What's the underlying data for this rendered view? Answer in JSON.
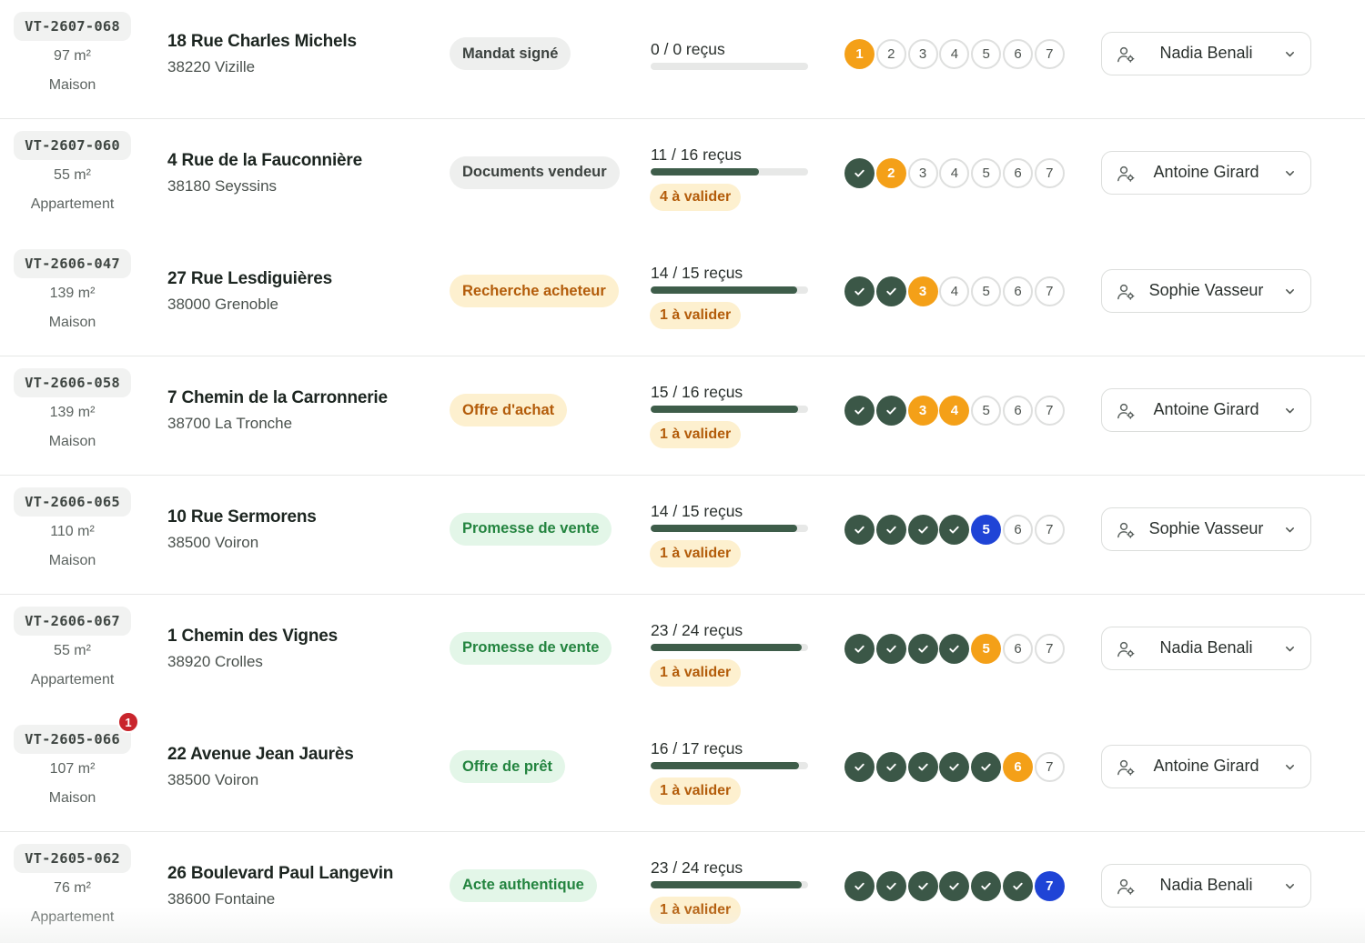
{
  "rows": [
    {
      "ref": "VT-2607-068",
      "area": "97 m²",
      "type": "Maison",
      "street": "18 Rue Charles Michels",
      "city": "38220 Vizille",
      "status": "Mandat signé",
      "status_tone": "neutral",
      "docs": "0 / 0 reçus",
      "progress": 0,
      "pending": "",
      "steps": [
        "cur",
        "todo",
        "todo",
        "todo",
        "todo",
        "todo",
        "todo"
      ],
      "assignee": "Nadia Benali",
      "notif": ""
    },
    {
      "ref": "VT-2607-060",
      "area": "55 m²",
      "type": "Appartement",
      "street": "4 Rue de la Fauconnière",
      "city": "38180 Seyssins",
      "status": "Documents vendeur",
      "status_tone": "neutral",
      "docs": "11 / 16 reçus",
      "progress": 0.6875,
      "pending": "4 à valider",
      "steps": [
        "done",
        "cur",
        "todo",
        "todo",
        "todo",
        "todo",
        "todo"
      ],
      "assignee": "Antoine Girard",
      "notif": ""
    },
    {
      "ref": "VT-2606-047",
      "area": "139 m²",
      "type": "Maison",
      "street": "27 Rue Lesdiguières",
      "city": "38000 Grenoble",
      "status": "Recherche acheteur",
      "status_tone": "amber",
      "docs": "14 / 15 reçus",
      "progress": 0.9333,
      "pending": "1 à valider",
      "steps": [
        "done",
        "done",
        "cur",
        "todo",
        "todo",
        "todo",
        "todo"
      ],
      "assignee": "Sophie Vasseur",
      "notif": ""
    },
    {
      "ref": "VT-2606-058",
      "area": "139 m²",
      "type": "Maison",
      "street": "7 Chemin de la Carronnerie",
      "city": "38700 La Tronche",
      "status": "Offre d'achat",
      "status_tone": "amber",
      "docs": "15 / 16 reçus",
      "progress": 0.9375,
      "pending": "1 à valider",
      "steps": [
        "done",
        "done",
        "cur",
        "cur",
        "todo",
        "todo",
        "todo"
      ],
      "assignee": "Antoine Girard",
      "notif": ""
    },
    {
      "ref": "VT-2606-065",
      "area": "110 m²",
      "type": "Maison",
      "street": "10 Rue Sermorens",
      "city": "38500 Voiron",
      "status": "Promesse de vente",
      "status_tone": "green",
      "docs": "14 / 15 reçus",
      "progress": 0.9333,
      "pending": "1 à valider",
      "steps": [
        "done",
        "done",
        "done",
        "done",
        "final",
        "todo",
        "todo"
      ],
      "assignee": "Sophie Vasseur",
      "notif": ""
    },
    {
      "ref": "VT-2606-067",
      "area": "55 m²",
      "type": "Appartement",
      "street": "1 Chemin des Vignes",
      "city": "38920 Crolles",
      "status": "Promesse de vente",
      "status_tone": "green",
      "docs": "23 / 24 reçus",
      "progress": 0.9583,
      "pending": "1 à valider",
      "steps": [
        "done",
        "done",
        "done",
        "done",
        "cur",
        "todo",
        "todo"
      ],
      "assignee": "Nadia Benali",
      "notif": ""
    },
    {
      "ref": "VT-2605-066",
      "area": "107 m²",
      "type": "Maison",
      "street": "22 Avenue Jean Jaurès",
      "city": "38500 Voiron",
      "status": "Offre de prêt",
      "status_tone": "green",
      "docs": "16 / 17 reçus",
      "progress": 0.9412,
      "pending": "1 à valider",
      "steps": [
        "done",
        "done",
        "done",
        "done",
        "done",
        "cur",
        "todo"
      ],
      "assignee": "Antoine Girard",
      "notif": "1"
    },
    {
      "ref": "VT-2605-062",
      "area": "76 m²",
      "type": "Appartement",
      "street": "26 Boulevard Paul Langevin",
      "city": "38600 Fontaine",
      "status": "Acte authentique",
      "status_tone": "green",
      "docs": "23 / 24 reçus",
      "progress": 0.9583,
      "pending": "1 à valider",
      "steps": [
        "done",
        "done",
        "done",
        "done",
        "done",
        "done",
        "final"
      ],
      "assignee": "Nadia Benali",
      "notif": ""
    }
  ],
  "icons": {
    "step_done": "check-icon",
    "assignee": "user-gear-icon",
    "dropdown": "chevron-down-icon"
  },
  "colors": {
    "done": "#3b5747",
    "current": "#f4a018",
    "final": "#1f44d6",
    "bar": "#3e5d4a",
    "amber_text": "#b35c0a",
    "green_text": "#23843f",
    "notif": "#c9252c"
  }
}
